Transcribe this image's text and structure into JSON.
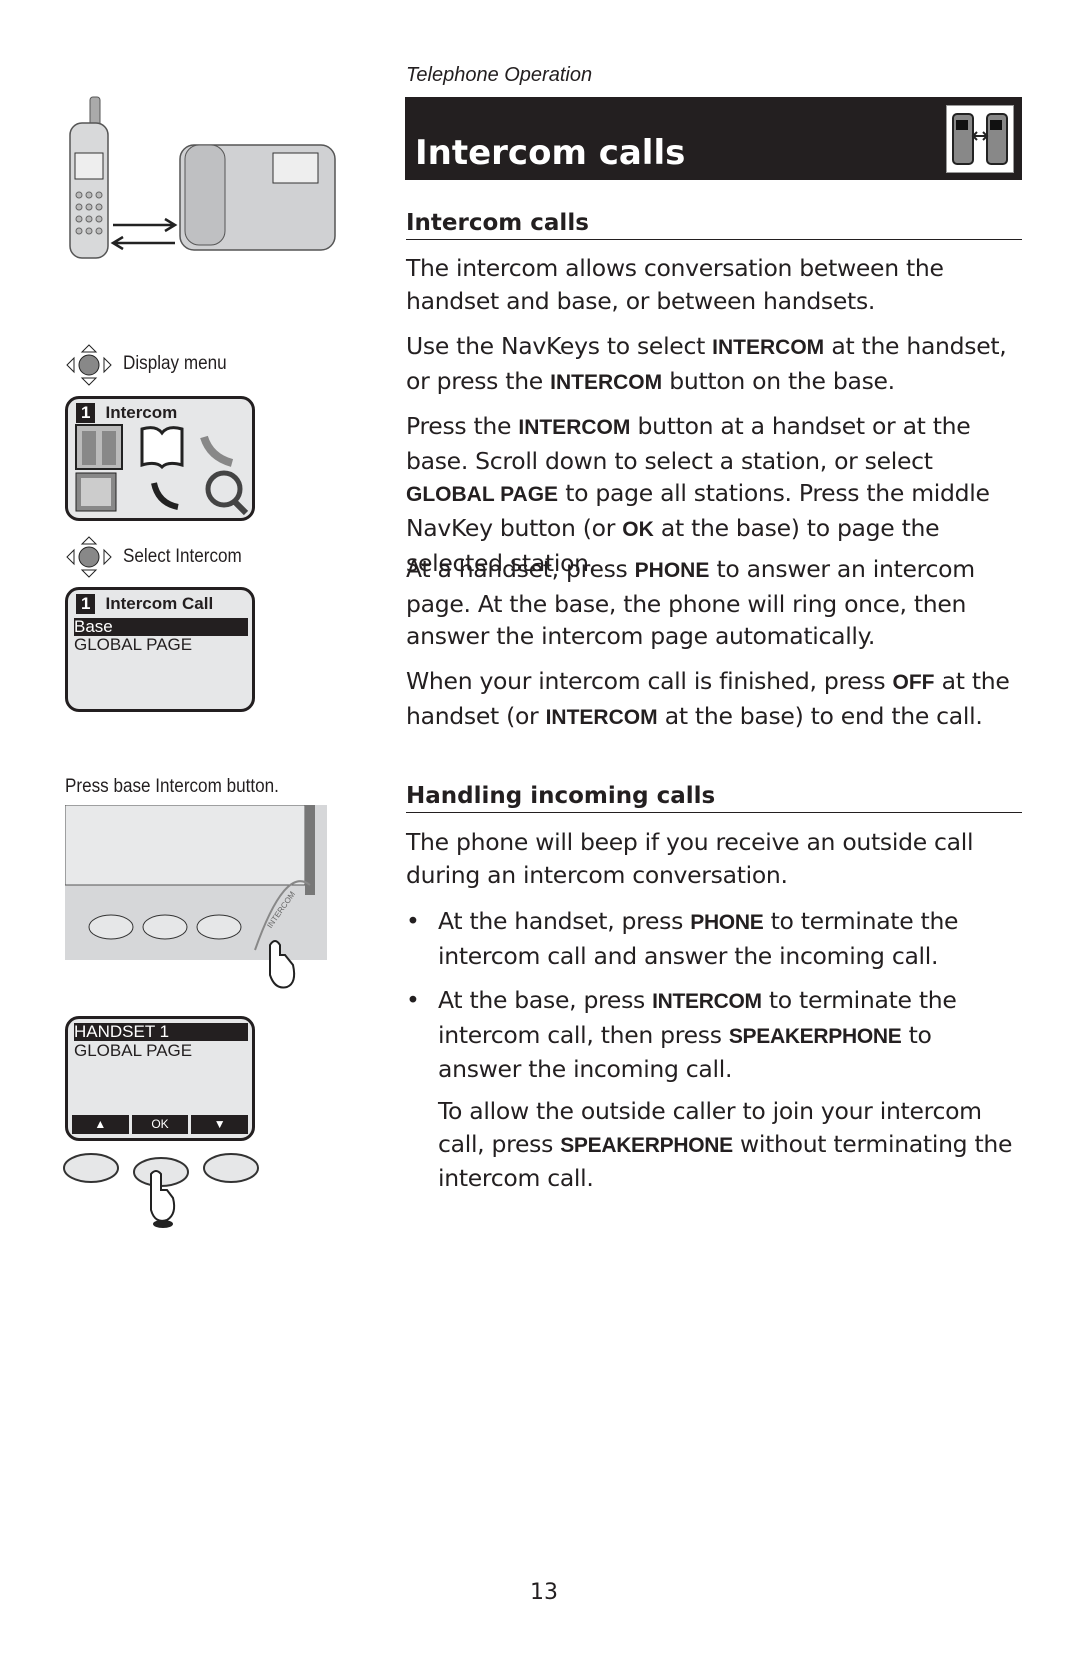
{
  "section_label": "Telephone Operation",
  "title": "Intercom calls",
  "intercom": {
    "heading": "Intercom calls",
    "p1": "The intercom allows conversation between the handset and base, or between handsets.",
    "p2": [
      "Use the NavKeys to select ",
      "INTERCOM",
      " at the handset, or press the ",
      "INTERCOM",
      " button on the base."
    ],
    "p3": [
      "Press the ",
      "INTERCOM",
      " button at a handset or at the base. Scroll down to select a station, or select ",
      "GLOBAL PAGE",
      " to page all stations. Press the middle NavKey button (or ",
      "OK",
      " at the base) to page the selected station."
    ],
    "p4": [
      "At a handset, press ",
      "PHONE",
      " to answer an intercom page. At the base, the phone will ring once, then answer the intercom page automatically."
    ],
    "p5": [
      "When your intercom call is finished, press ",
      "OFF",
      " at the handset (or ",
      "INTERCOM",
      " at the base) to end the call."
    ]
  },
  "incoming": {
    "heading": "Handling incoming calls",
    "p1": "The phone will beep if you receive an outside call during an intercom conversation.",
    "bullet_symbol": "•",
    "b1": [
      "At the handset, press ",
      "PHONE",
      " to terminate the intercom call and answer the incoming call."
    ],
    "b2": [
      "At the base, press ",
      "INTERCOM",
      " to terminate the intercom call, then press ",
      "SPEAKERPHONE",
      " to answer the incoming call."
    ],
    "p2": [
      "To allow the outside caller to join your intercom call, press ",
      "SPEAKERPHONE",
      " without terminating the intercom call."
    ]
  },
  "sidebar": {
    "step1": "Display menu",
    "screen1": {
      "num": "1",
      "title": "Intercom"
    },
    "step2": "Select Intercom",
    "screen2": {
      "num": "1",
      "title": "Intercom Call",
      "selected": "Base",
      "row2": "GLOBAL PAGE"
    },
    "step3": "Press base Intercom button.",
    "base_label": "INTERCOM",
    "screen3": {
      "selected": "HANDSET 1",
      "row2": "GLOBAL PAGE",
      "softkeys": [
        "▲",
        "OK",
        "▼"
      ]
    }
  },
  "page_number": "13"
}
